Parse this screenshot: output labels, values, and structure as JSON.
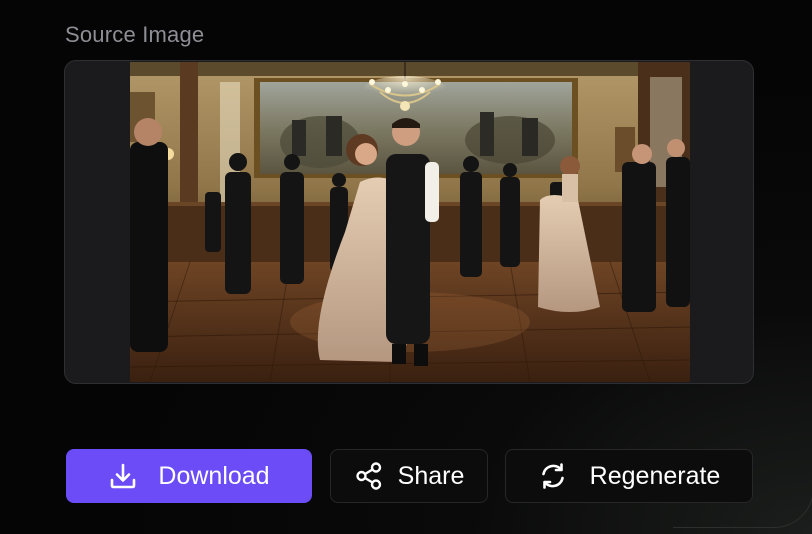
{
  "section": {
    "title": "Source Image"
  },
  "image": {
    "alt": "Couples dancing in an elegant ballroom with a chandelier and large painting"
  },
  "actions": {
    "download_label": "Download",
    "share_label": "Share",
    "regenerate_label": "Regenerate"
  },
  "icons": {
    "download": "download-icon",
    "share": "share-icon",
    "regenerate": "refresh-icon"
  },
  "colors": {
    "accent": "#6b4cf6",
    "background": "#050505",
    "label": "#8e8e95"
  }
}
